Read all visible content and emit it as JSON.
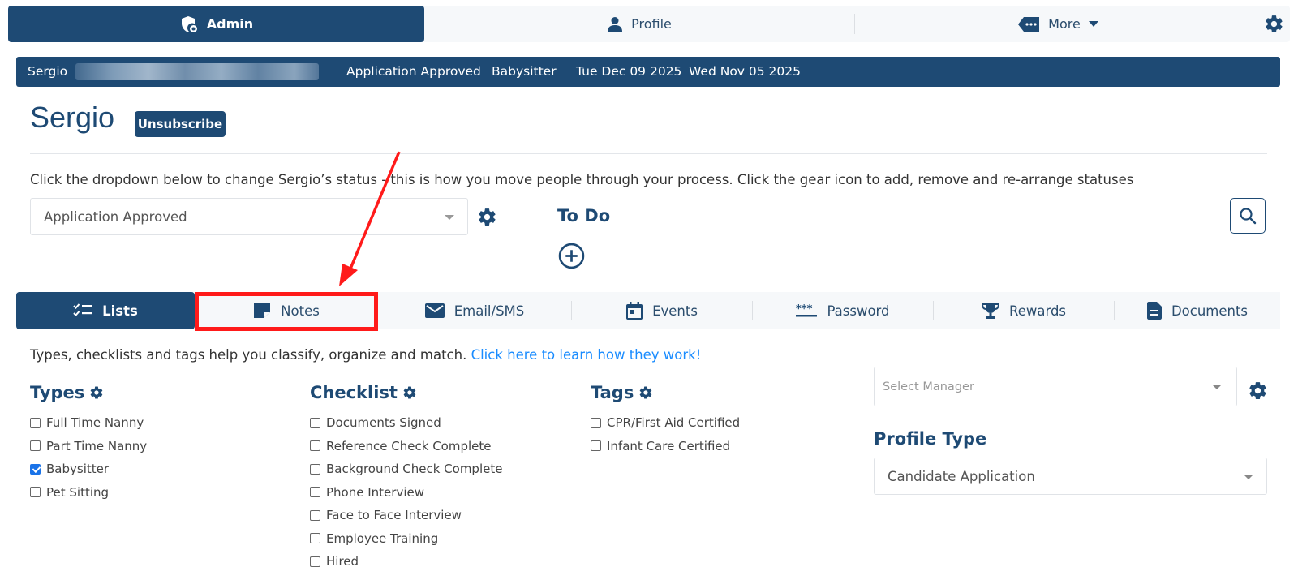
{
  "topnav": {
    "admin_label": "Admin",
    "profile_label": "Profile",
    "more_label": "More"
  },
  "infobar": {
    "name": "Sergio",
    "status": "Application Approved",
    "type": "Babysitter",
    "date1": "Tue Dec 09 2025",
    "date2": "Wed Nov 05 2025"
  },
  "header": {
    "title": "Sergio",
    "unsubscribe_label": "Unsubscribe",
    "instruction": "Click the dropdown below to change Sergio’s status - this is how you move people through your process. Click the gear icon to add, remove and re-arrange statuses"
  },
  "status": {
    "selected": "Application Approved"
  },
  "todo": {
    "title": "To Do"
  },
  "tabs": [
    {
      "label": "Lists",
      "icon": "checklist-icon"
    },
    {
      "label": "Notes",
      "icon": "note-icon"
    },
    {
      "label": "Email/SMS",
      "icon": "envelope-icon"
    },
    {
      "label": "Events",
      "icon": "calendar-icon"
    },
    {
      "label": "Password",
      "icon": "password-icon"
    },
    {
      "label": "Rewards",
      "icon": "trophy-icon"
    },
    {
      "label": "Documents",
      "icon": "document-icon"
    }
  ],
  "lists": {
    "intro": "Types, checklists and tags help you classify, organize and match. ",
    "learn_link": "Click here to learn how they work!",
    "types": {
      "title": "Types",
      "items": [
        {
          "label": "Full Time Nanny",
          "checked": false
        },
        {
          "label": "Part Time Nanny",
          "checked": false
        },
        {
          "label": "Babysitter",
          "checked": true
        },
        {
          "label": "Pet Sitting",
          "checked": false
        }
      ]
    },
    "checklist": {
      "title": "Checklist",
      "items": [
        {
          "label": "Documents Signed",
          "checked": false
        },
        {
          "label": "Reference Check Complete",
          "checked": false
        },
        {
          "label": "Background Check Complete",
          "checked": false
        },
        {
          "label": "Phone Interview",
          "checked": false
        },
        {
          "label": "Face to Face Interview",
          "checked": false
        },
        {
          "label": "Employee Training",
          "checked": false
        },
        {
          "label": "Hired",
          "checked": false
        }
      ]
    },
    "tags": {
      "title": "Tags",
      "items": [
        {
          "label": "CPR/First Aid Certified",
          "checked": false
        },
        {
          "label": "Infant Care Certified",
          "checked": false
        }
      ]
    }
  },
  "manager": {
    "placeholder": "Select Manager"
  },
  "profile_type": {
    "title": "Profile Type",
    "selected": "Candidate Application"
  },
  "colors": {
    "primary": "#1e4a74",
    "link": "#1a8cff",
    "highlight": "#ff1a1a",
    "checkbox": "#1a73e8"
  }
}
